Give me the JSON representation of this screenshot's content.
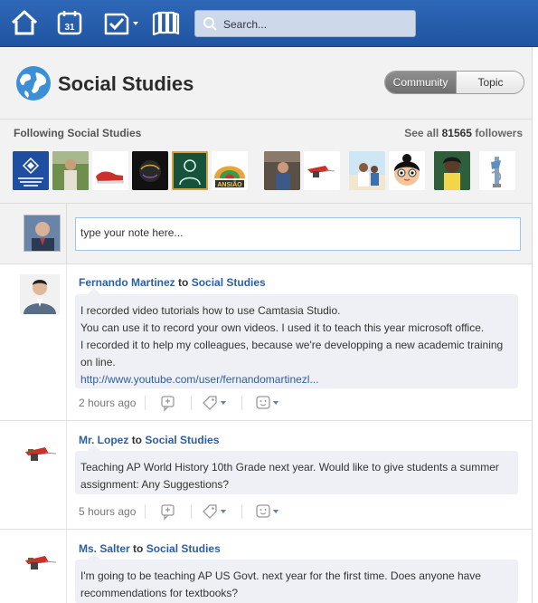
{
  "nav": {
    "icons": [
      "home-icon",
      "calendar-icon",
      "assignments-icon",
      "library-icon"
    ],
    "calendar_day": "31",
    "search_placeholder": "Search..."
  },
  "group": {
    "title": "Social Studies",
    "toggle": {
      "community": "Community",
      "topic": "Topic",
      "active": "Community"
    }
  },
  "followers": {
    "label": "Following Social Studies",
    "see_all_prefix": "See all",
    "count": "81565",
    "see_all_suffix": "followers"
  },
  "composer": {
    "placeholder": "type your note here..."
  },
  "posts": [
    {
      "author": "Fernando Martinez",
      "to_word": "to",
      "target": "Social Studies",
      "lines": [
        "I recorded video tutorials how to use Camtasia Studio.",
        "You can use it to record your own videos. I used it to teach this year microsoft office.",
        "I recorded it to help my colleagues, because we're developping a new academic training",
        "on line."
      ],
      "link": "http://www.youtube.com/user/fernandomartinezl...",
      "time": "2 hours ago"
    },
    {
      "author": "Mr. Lopez",
      "to_word": "to",
      "target": "Social Studies",
      "lines": [
        "Teaching AP World History 10th Grade next year. Would like to give students a summer",
        "assignment: Any Suggestions?"
      ],
      "time": "5 hours ago"
    },
    {
      "author": "Ms. Salter",
      "to_word": "to",
      "target": "Social Studies",
      "lines": [
        "I'm going to be teaching AP US Govt. next year for the first time. Does anyone have",
        "recommendations for textbooks?"
      ]
    }
  ],
  "colors": {
    "topbar": "#2f68b8",
    "link": "#2d5f9e",
    "bubble": "#eef0f5"
  }
}
